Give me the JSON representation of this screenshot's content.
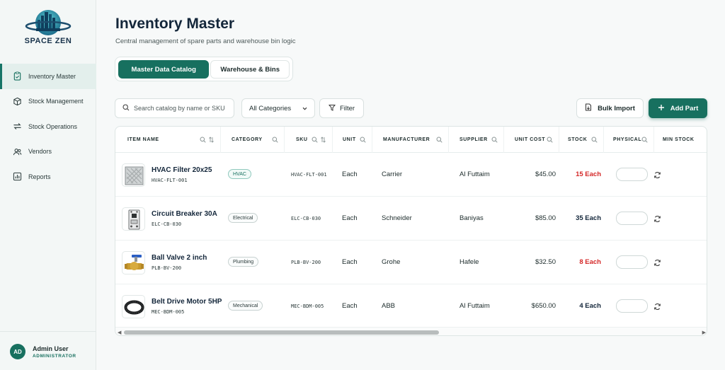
{
  "app": {
    "logo_text": "SPACE ZEN"
  },
  "sidebar": {
    "items": [
      {
        "label": "Inventory Master",
        "icon": "clipboard-icon",
        "active": true
      },
      {
        "label": "Stock Management",
        "icon": "box-icon",
        "active": false
      },
      {
        "label": "Stock Operations",
        "icon": "swap-icon",
        "active": false
      },
      {
        "label": "Vendors",
        "icon": "users-icon",
        "active": false
      },
      {
        "label": "Reports",
        "icon": "chart-icon",
        "active": false
      }
    ],
    "user": {
      "initials": "AD",
      "name": "Admin User",
      "role": "ADMINISTRATOR"
    }
  },
  "header": {
    "title": "Inventory Master",
    "subtitle": "Central management of spare parts and warehouse bin logic"
  },
  "tabs": [
    {
      "label": "Master Data Catalog",
      "active": true
    },
    {
      "label": "Warehouse & Bins",
      "active": false
    }
  ],
  "toolbar": {
    "search_placeholder": "Search catalog by name or SKU",
    "category_select": "All Categories",
    "filter_label": "Filter",
    "bulk_import_label": "Bulk Import",
    "add_part_label": "Add Part"
  },
  "table": {
    "columns": [
      "ITEM NAME",
      "CATEGORY",
      "SKU",
      "UNIT",
      "MANUFACTURER",
      "SUPPLIER",
      "UNIT COST",
      "STOCK",
      "PHYSICAL",
      "MIN STOCK"
    ],
    "rows": [
      {
        "name": "HVAC Filter 20x25",
        "sku": "HVAC-FLT-001",
        "category": "HVAC",
        "unit": "Each",
        "manufacturer": "Carrier",
        "supplier": "Al Futtaim",
        "unit_cost": "$45.00",
        "stock": "15 Each",
        "stock_low": true
      },
      {
        "name": "Circuit Breaker 30A",
        "sku": "ELC-CB-030",
        "category": "Electrical",
        "unit": "Each",
        "manufacturer": "Schneider",
        "supplier": "Baniyas",
        "unit_cost": "$85.00",
        "stock": "35 Each",
        "stock_low": false
      },
      {
        "name": "Ball Valve 2 inch",
        "sku": "PLB-BV-200",
        "category": "Plumbing",
        "unit": "Each",
        "manufacturer": "Grohe",
        "supplier": "Hafele",
        "unit_cost": "$32.50",
        "stock": "8 Each",
        "stock_low": true
      },
      {
        "name": "Belt Drive Motor 5HP",
        "sku": "MEC-BDM-005",
        "category": "Mechanical",
        "unit": "Each",
        "manufacturer": "ABB",
        "supplier": "Al Futtaim",
        "unit_cost": "$650.00",
        "stock": "4 Each",
        "stock_low": false
      }
    ]
  },
  "colors": {
    "accent": "#17705f",
    "stock_low": "#d42828",
    "title": "#13263a"
  }
}
